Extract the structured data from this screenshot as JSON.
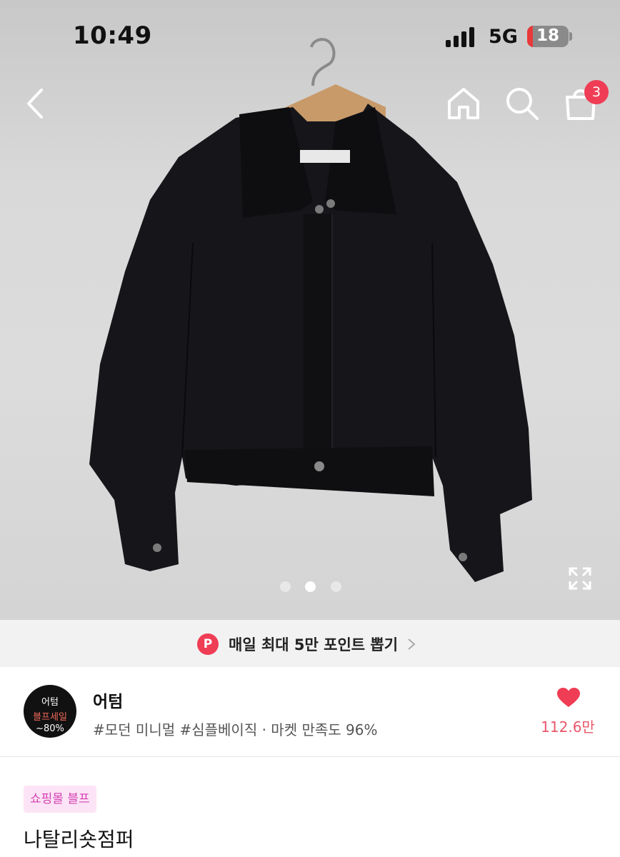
{
  "status_bar": {
    "time": "10:49",
    "network": "5G",
    "battery": "18",
    "battery_color": "#e8393a"
  },
  "nav": {
    "icons": [
      "back-icon",
      "home-icon",
      "search-icon",
      "shopping-bag-icon"
    ],
    "cart_badge": "3",
    "badge_color": "#ef3d55"
  },
  "carousel": {
    "total": 3,
    "active_index": 2
  },
  "points_banner": {
    "icon_letter": "P",
    "text": "매일 최대 5만 포인트 뽑기"
  },
  "store": {
    "logo_line1": "어텀",
    "logo_line2": "블프세일",
    "logo_line3": "~80%",
    "name": "어텀",
    "tags": "#모던 미니멀 #심플베이직 · 마켓 만족도 96%",
    "likes": "112.6만",
    "like_color": "#ef3d55"
  },
  "product": {
    "tag": "쇼핑몰 블프",
    "name": "나탈리숏점퍼"
  }
}
